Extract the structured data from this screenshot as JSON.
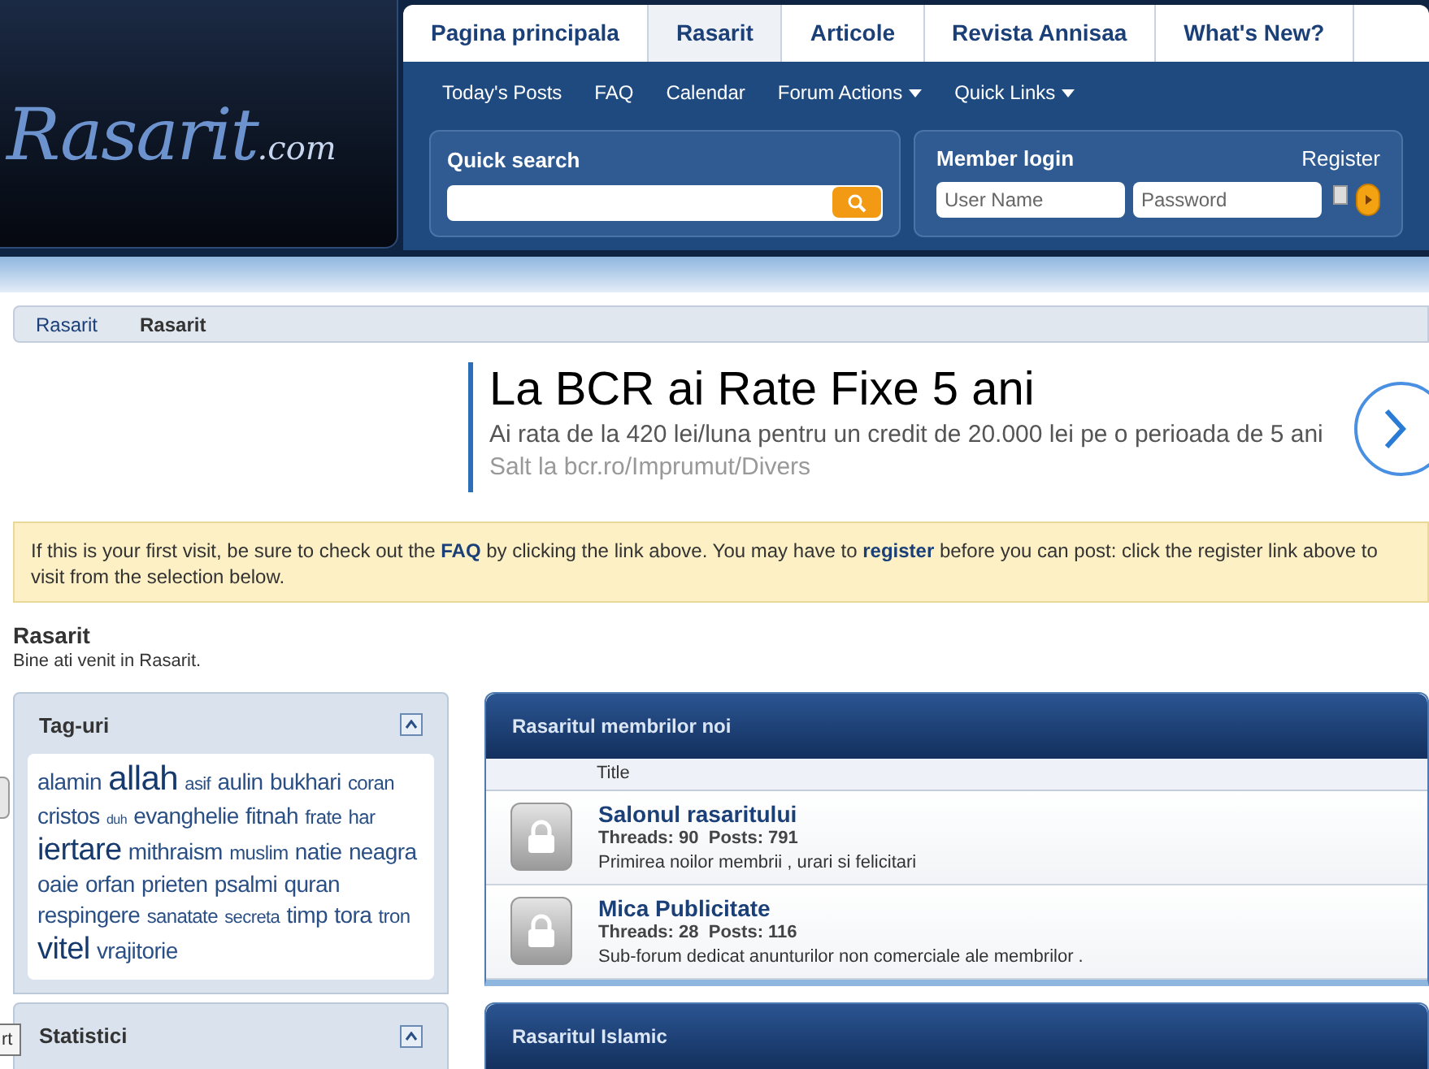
{
  "logo": {
    "name": "Rasarit",
    "suffix": ".com"
  },
  "tabs": [
    {
      "label": "Pagina principala",
      "selected": false
    },
    {
      "label": "Rasarit",
      "selected": true
    },
    {
      "label": "Articole",
      "selected": false
    },
    {
      "label": "Revista Annisaa",
      "selected": false
    },
    {
      "label": "What's New?",
      "selected": false
    }
  ],
  "subnav": [
    {
      "label": "Today's Posts",
      "dropdown": false
    },
    {
      "label": "FAQ",
      "dropdown": false
    },
    {
      "label": "Calendar",
      "dropdown": false
    },
    {
      "label": "Forum Actions",
      "dropdown": true
    },
    {
      "label": "Quick Links",
      "dropdown": true
    }
  ],
  "quick_search": {
    "title": "Quick search"
  },
  "member_login": {
    "title": "Member login",
    "register": "Register",
    "username_placeholder": "User Name",
    "password_placeholder": "Password",
    "remember_checked": false
  },
  "breadcrumb": [
    "Rasarit",
    "Rasarit"
  ],
  "ad": {
    "headline": "La BCR ai Rate Fixe 5 ani",
    "body": "Ai rata de la 420 lei/luna pentru un credit de 20.000 lei pe o perioada de 5 ani",
    "link": "Salt la bcr.ro/Imprumut/Divers"
  },
  "notice": {
    "text": "If this is your first visit, be sure to check out the **FAQ** by clicking the link above. You may have to **register** before you can post: click the register link above to",
    "text_2": "visit from the selection below."
  },
  "welcome": {
    "title": "Rasarit",
    "subtitle": "Bine ati venit in Rasarit."
  },
  "sidebar": [
    {
      "title": "Tag-uri",
      "expanded": true,
      "tags": [
        {
          "label": "alamin",
          "kind": "medium"
        },
        {
          "label": "allah",
          "kind": "xlarge"
        },
        {
          "label": "asif",
          "kind": "tiny"
        },
        {
          "label": "aulin",
          "kind": "medium"
        },
        {
          "label": "bukhari",
          "kind": "medium"
        },
        {
          "label": "coran",
          "kind": "small"
        },
        {
          "label": "cristos",
          "kind": "medium"
        },
        {
          "label": "duh",
          "kind": "micro"
        },
        {
          "label": "evanghelie",
          "kind": "medium"
        },
        {
          "label": "fitnah",
          "kind": "medium"
        },
        {
          "label": "frate",
          "kind": "small"
        },
        {
          "label": "har",
          "kind": "small"
        },
        {
          "label": "iertare",
          "kind": "large"
        },
        {
          "label": "mithraism",
          "kind": "medium"
        },
        {
          "label": "muslim",
          "kind": "small"
        },
        {
          "label": "natie",
          "kind": "medium"
        },
        {
          "label": "neagra",
          "kind": "medium"
        },
        {
          "label": "oaie",
          "kind": "medium"
        },
        {
          "label": "orfan",
          "kind": "medium"
        },
        {
          "label": "prieten",
          "kind": "medium"
        },
        {
          "label": "psalmi",
          "kind": "medium"
        },
        {
          "label": "quran",
          "kind": "medium"
        },
        {
          "label": "respingere",
          "kind": "medium"
        },
        {
          "label": "sanatate",
          "kind": "small"
        },
        {
          "label": "secreta",
          "kind": "tiny"
        },
        {
          "label": "timp",
          "kind": "medium"
        },
        {
          "label": "tora",
          "kind": "medium"
        },
        {
          "label": "tron",
          "kind": "small"
        },
        {
          "label": "vitel",
          "kind": "large"
        },
        {
          "label": "vrajitorie",
          "kind": "medium"
        }
      ]
    },
    {
      "title": "Statistici",
      "expanded": true
    }
  ],
  "tooltip": "rt",
  "forums": [
    {
      "title": "Rasaritul membrilor noi",
      "column": "Title",
      "rows": [
        {
          "name": "Salonul rasaritului",
          "stats": "Threads: 90  Posts: 791",
          "description": "Primirea noilor membrii , urari si felicitari"
        },
        {
          "name": "Mica Publicitate",
          "stats": "Threads: 28  Posts: 116",
          "description": "Sub-forum dedicat anunturilor non comerciale ale membrilor ."
        }
      ]
    },
    {
      "title": "Rasaritul Islamic"
    }
  ]
}
